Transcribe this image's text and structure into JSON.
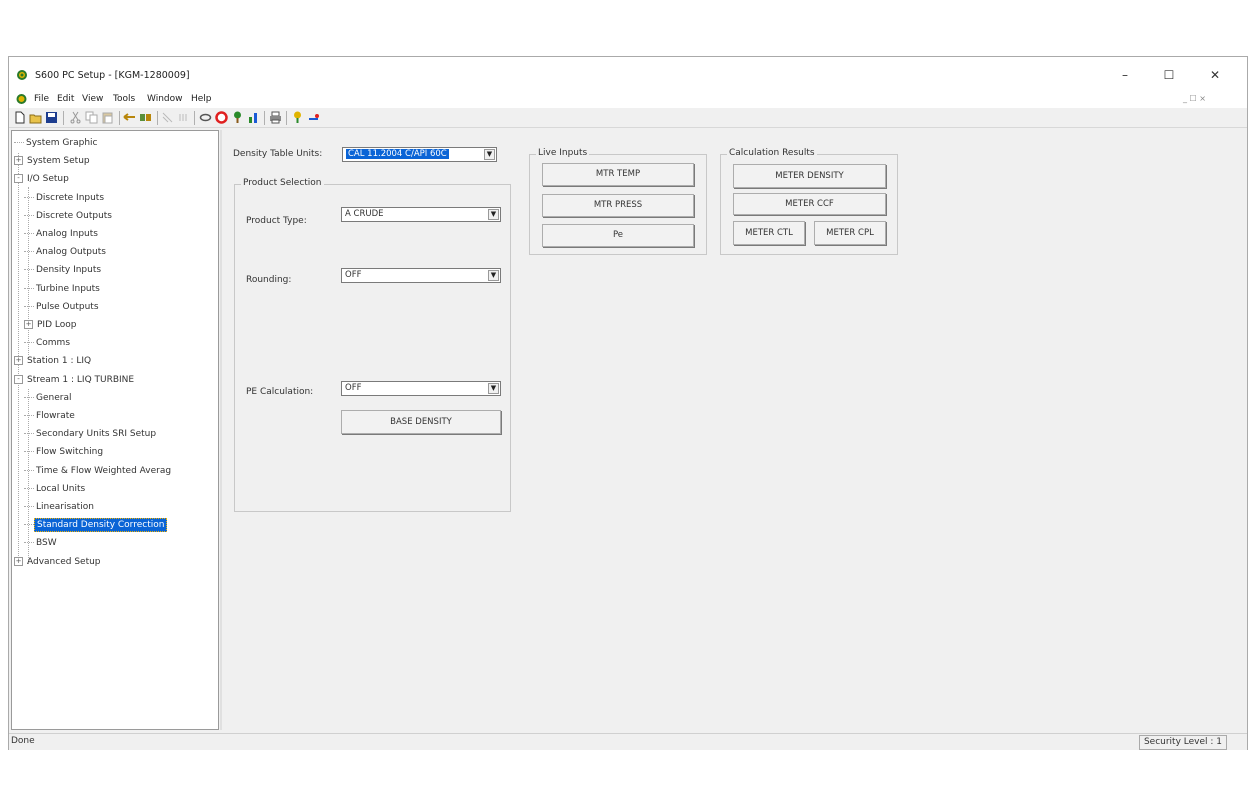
{
  "window": {
    "title": "S600 PC Setup - [KGM-1280009]",
    "controls": {
      "minimize": "–",
      "maximize": "☐",
      "close": "✕"
    }
  },
  "menu": {
    "items": [
      "File",
      "Edit",
      "View",
      "Tools",
      "Window",
      "Help"
    ],
    "mdi_controls": "_ ☐ ×"
  },
  "toolbar": {
    "icons": [
      "new-file-icon",
      "open-folder-icon",
      "save-icon",
      "cut-icon",
      "copy-icon",
      "paste-icon",
      "back-arrow-icon",
      "transfer-icon",
      "connect-icon",
      "disconnect-icon",
      "link-icon",
      "stop-icon",
      "tree-icon",
      "chart-icon",
      "print-icon",
      "help-icon",
      "about-icon"
    ]
  },
  "tree": {
    "items": [
      {
        "label": "System Graphic",
        "level": 0,
        "expander": ""
      },
      {
        "label": "System Setup",
        "level": 0,
        "expander": "+"
      },
      {
        "label": "I/O Setup",
        "level": 0,
        "expander": "-"
      },
      {
        "label": "Discrete Inputs",
        "level": 1,
        "expander": ""
      },
      {
        "label": "Discrete Outputs",
        "level": 1,
        "expander": ""
      },
      {
        "label": "Analog Inputs",
        "level": 1,
        "expander": ""
      },
      {
        "label": "Analog Outputs",
        "level": 1,
        "expander": ""
      },
      {
        "label": "Density Inputs",
        "level": 1,
        "expander": ""
      },
      {
        "label": "Turbine Inputs",
        "level": 1,
        "expander": ""
      },
      {
        "label": "Pulse Outputs",
        "level": 1,
        "expander": ""
      },
      {
        "label": "PID Loop",
        "level": 1,
        "expander": "+"
      },
      {
        "label": "Comms",
        "level": 1,
        "expander": ""
      },
      {
        "label": "Station 1 : LIQ",
        "level": 0,
        "expander": "+"
      },
      {
        "label": "Stream 1 : LIQ TURBINE",
        "level": 0,
        "expander": "-"
      },
      {
        "label": "General",
        "level": 1,
        "expander": ""
      },
      {
        "label": "Flowrate",
        "level": 1,
        "expander": ""
      },
      {
        "label": "Secondary Units SRI Setup",
        "level": 1,
        "expander": ""
      },
      {
        "label": "Flow Switching",
        "level": 1,
        "expander": ""
      },
      {
        "label": "Time & Flow Weighted Averag",
        "level": 1,
        "expander": ""
      },
      {
        "label": "Local Units",
        "level": 1,
        "expander": ""
      },
      {
        "label": "Linearisation",
        "level": 1,
        "expander": ""
      },
      {
        "label": "Standard Density Correction",
        "level": 1,
        "expander": "",
        "selected": true
      },
      {
        "label": "BSW",
        "level": 1,
        "expander": ""
      },
      {
        "label": "Advanced Setup",
        "level": 0,
        "expander": "+"
      }
    ],
    "scroll_left": "<",
    "scroll_right": ">"
  },
  "form": {
    "density_table_units_label": "Density Table Units:",
    "density_table_units_value": "CAL 11.2004 C/API 60C",
    "product_selection_title": "Product Selection",
    "product_type_label": "Product Type:",
    "product_type_value": "A CRUDE",
    "rounding_label": "Rounding:",
    "rounding_value": "OFF",
    "pe_calculation_label": "PE Calculation:",
    "pe_calculation_value": "OFF",
    "base_density_button": "BASE DENSITY",
    "live_inputs_title": "Live Inputs",
    "mtr_temp_button": "MTR TEMP",
    "mtr_press_button": "MTR PRESS",
    "pe_button": "Pe",
    "calc_results_title": "Calculation Results",
    "meter_density_button": "METER DENSITY",
    "meter_ccf_button": "METER CCF",
    "meter_ctl_button": "METER CTL",
    "meter_cpl_button": "METER CPL"
  },
  "status": {
    "left": "Done",
    "right": "Security Level : 1"
  }
}
